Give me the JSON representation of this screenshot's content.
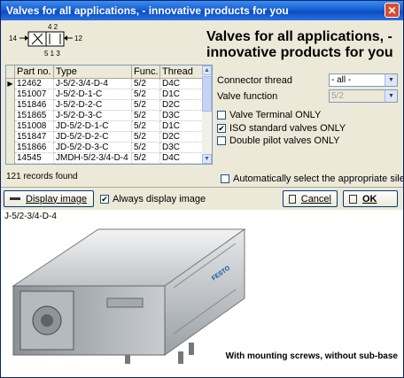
{
  "window": {
    "title": "Valves for all applications, - innovative products for you"
  },
  "header": {
    "title": "Valves for all applications, - innovative products for you"
  },
  "symbol": {
    "left_port": "14",
    "right_port": "12",
    "top_ports": "4  2",
    "bottom_ports": "5 1 3"
  },
  "grid": {
    "columns": [
      "Part no.",
      "Type",
      "Func.",
      "Thread"
    ],
    "rows": [
      [
        "12462",
        "J-5/2-3/4-D-4",
        "5/2",
        "D4C"
      ],
      [
        "151007",
        "J-5/2-D-1-C",
        "5/2",
        "D1C"
      ],
      [
        "151846",
        "J-5/2-D-2-C",
        "5/2",
        "D2C"
      ],
      [
        "151865",
        "J-5/2-D-3-C",
        "5/2",
        "D3C"
      ],
      [
        "151008",
        "JD-5/2-D-1-C",
        "5/2",
        "D1C"
      ],
      [
        "151847",
        "JD-5/2-D-2-C",
        "5/2",
        "D2C"
      ],
      [
        "151866",
        "JD-5/2-D-3-C",
        "5/2",
        "D3C"
      ],
      [
        "14545",
        "JMDH-5/2-3/4-D-4",
        "5/2",
        "D4C"
      ]
    ],
    "selected_row": 0
  },
  "records": "121 records found",
  "filters": {
    "connector_thread_label": "Connector thread",
    "connector_thread_value": "- all -",
    "valve_function_label": "Valve function",
    "valve_function_value": "5/2",
    "valve_terminal_only": "Valve Terminal ONLY",
    "valve_terminal_checked": false,
    "iso_standard_only": "ISO standard valves ONLY",
    "iso_standard_checked": true,
    "double_pilot_only": "Double pilot valves ONLY",
    "double_pilot_checked": false,
    "auto_silencer": "Automatically select the appropriate silencer.",
    "auto_silencer_checked": false
  },
  "toolbar": {
    "display_image": "Display image",
    "always_display_image": "Always display image",
    "always_display_checked": true,
    "cancel": "Cancel",
    "ok": "OK"
  },
  "image": {
    "caption_top": "J-5/2-3/4-D-4",
    "caption_bottom": "With mounting screws, without sub-base",
    "brand": "FESTO"
  },
  "icons": {
    "close": "close-icon",
    "row_pointer": "row-pointer-icon",
    "dropdown": "chevron-down-icon",
    "display_image": "image-icon",
    "cancel": "cancel-icon",
    "ok": "ok-icon"
  }
}
